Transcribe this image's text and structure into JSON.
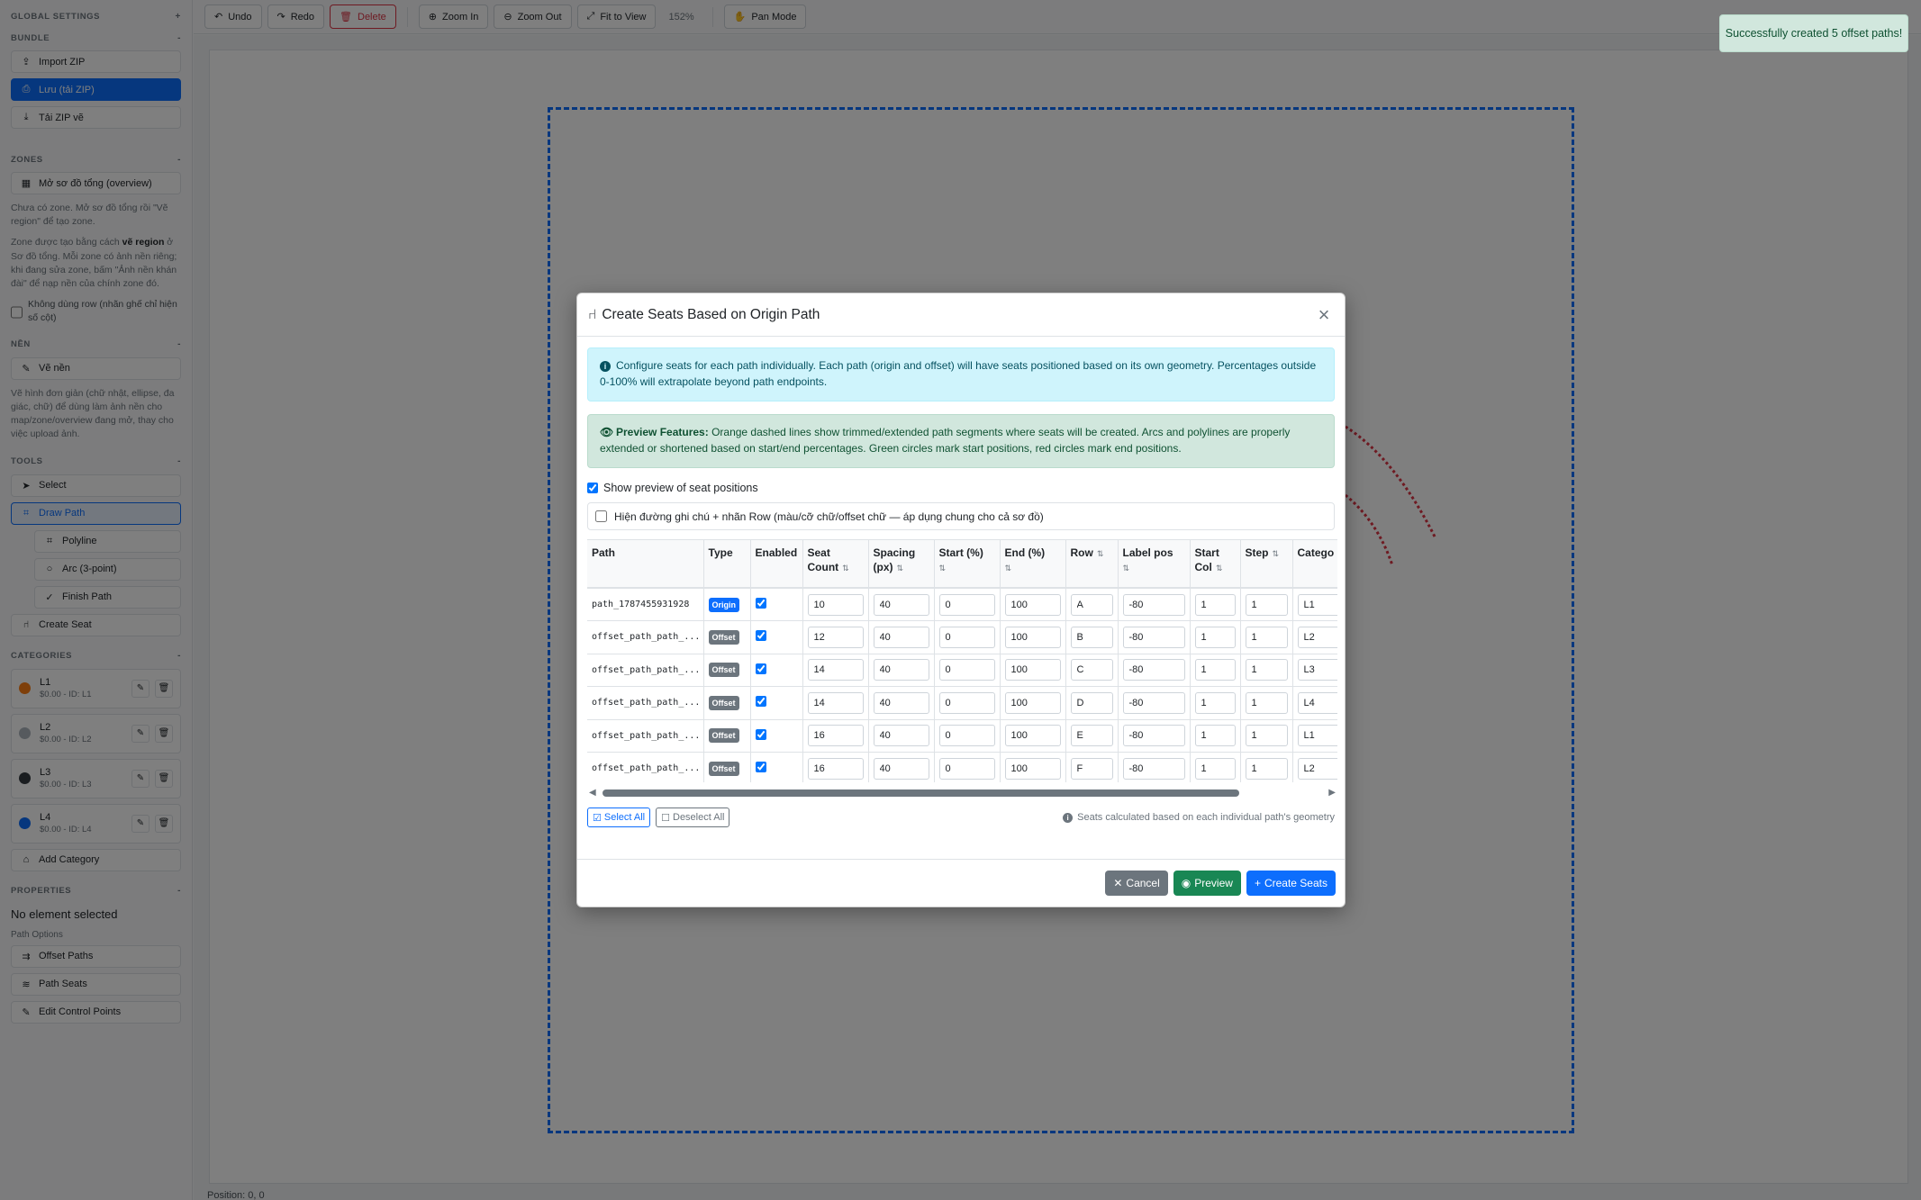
{
  "sidebar": {
    "global_settings": "GLOBAL SETTINGS",
    "bundle": {
      "title": "BUNDLE",
      "import": "Import ZIP",
      "save": "Lưu (tải ZIP)",
      "download": "Tải ZIP vẽ"
    },
    "zones": {
      "title": "ZONES",
      "open_overview": "Mở sơ đồ tổng (overview)",
      "text1": "Chưa có zone. Mở sơ đồ tổng rồi \"Vẽ region\" để tạo zone.",
      "text2_a": "Zone được tạo bằng cách",
      "text2_b": "vẽ region",
      "text2_c": "ở Sơ đồ tổng. Mỗi zone có ảnh nền riêng; khi đang sửa zone, bấm \"Ảnh nền khán đài\" để nạp nền của chính zone đó.",
      "checkbox": "Không dùng row (nhãn ghế chỉ hiện số cột)"
    },
    "background": {
      "title": "NỀN",
      "draw": "Vẽ nền",
      "text": "Vẽ hình đơn giản (chữ nhật, ellipse, đa giác, chữ) để dùng làm ảnh nền cho map/zone/overview đang mở, thay cho việc upload ảnh."
    },
    "tools": {
      "title": "TOOLS",
      "select": "Select",
      "draw_path": "Draw Path",
      "polyline": "Polyline",
      "arc": "Arc (3-point)",
      "finish": "Finish Path",
      "create_seat": "Create Seat"
    },
    "categories": {
      "title": "CATEGORIES",
      "items": [
        {
          "name": "L1",
          "sub": "$0.00 - ID: L1",
          "color": "#fd7e14"
        },
        {
          "name": "L2",
          "sub": "$0.00 - ID: L2",
          "color": "#adb5bd"
        },
        {
          "name": "L3",
          "sub": "$0.00 - ID: L3",
          "color": "#343a40"
        },
        {
          "name": "L4",
          "sub": "$0.00 - ID: L4",
          "color": "#0d6efd"
        }
      ],
      "add": "Add Category"
    },
    "properties": {
      "title": "PROPERTIES",
      "none": "No element selected",
      "path_options": "Path Options",
      "offset": "Offset Paths",
      "seats": "Path Seats",
      "control": "Edit Control Points"
    }
  },
  "toolbar": {
    "undo": "Undo",
    "redo": "Redo",
    "delete": "Delete",
    "zoom_in": "Zoom In",
    "zoom_out": "Zoom Out",
    "fit": "Fit to View",
    "zoom_level": "152%",
    "pan": "Pan Mode"
  },
  "status": "Position: 0, 0",
  "toast": "Successfully created 5 offset paths!",
  "modal": {
    "title": "Create Seats Based on Origin Path",
    "info": "Configure seats for each path individually. Each path (origin and offset) will have seats positioned based on its own geometry. Percentages outside 0-100% will extrapolate beyond path endpoints.",
    "preview_label": "Preview Features:",
    "preview_text": "Orange dashed lines show trimmed/extended path segments where seats will be created. Arcs and polylines are properly extended or shortened based on start/end percentages. Green circles mark start positions, red circles mark end positions.",
    "show_preview": "Show preview of seat positions",
    "row_note": "Hiện đường ghi chú + nhãn Row (màu/cỡ chữ/offset chữ — áp dụng chung cho cả sơ đồ)",
    "headers": {
      "path": "Path",
      "type": "Type",
      "enabled": "Enabled",
      "seat_count": "Seat Count",
      "spacing": "Spacing (px)",
      "start": "Start (%)",
      "end": "End (%)",
      "row": "Row",
      "label_pos": "Label pos",
      "start_col": "Start Col",
      "step": "Step",
      "category": "Catego"
    },
    "rows": [
      {
        "path": "path_1787455931928",
        "type": "Origin",
        "count": "10",
        "spacing": "40",
        "start": "0",
        "end": "100",
        "row": "A",
        "label": "-80",
        "col": "1",
        "step": "1",
        "cat": "L1"
      },
      {
        "path": "offset_path_path_...",
        "type": "Offset",
        "count": "12",
        "spacing": "40",
        "start": "0",
        "end": "100",
        "row": "B",
        "label": "-80",
        "col": "1",
        "step": "1",
        "cat": "L2"
      },
      {
        "path": "offset_path_path_...",
        "type": "Offset",
        "count": "14",
        "spacing": "40",
        "start": "0",
        "end": "100",
        "row": "C",
        "label": "-80",
        "col": "1",
        "step": "1",
        "cat": "L3"
      },
      {
        "path": "offset_path_path_...",
        "type": "Offset",
        "count": "14",
        "spacing": "40",
        "start": "0",
        "end": "100",
        "row": "D",
        "label": "-80",
        "col": "1",
        "step": "1",
        "cat": "L4"
      },
      {
        "path": "offset_path_path_...",
        "type": "Offset",
        "count": "16",
        "spacing": "40",
        "start": "0",
        "end": "100",
        "row": "E",
        "label": "-80",
        "col": "1",
        "step": "1",
        "cat": "L1"
      },
      {
        "path": "offset_path_path_...",
        "type": "Offset",
        "count": "16",
        "spacing": "40",
        "start": "0",
        "end": "100",
        "row": "F",
        "label": "-80",
        "col": "1",
        "step": "1",
        "cat": "L2"
      }
    ],
    "select_all": "Select All",
    "deselect_all": "Deselect All",
    "note": "Seats calculated based on each individual path's geometry",
    "cancel": "Cancel",
    "preview": "Preview",
    "create": "Create Seats"
  }
}
